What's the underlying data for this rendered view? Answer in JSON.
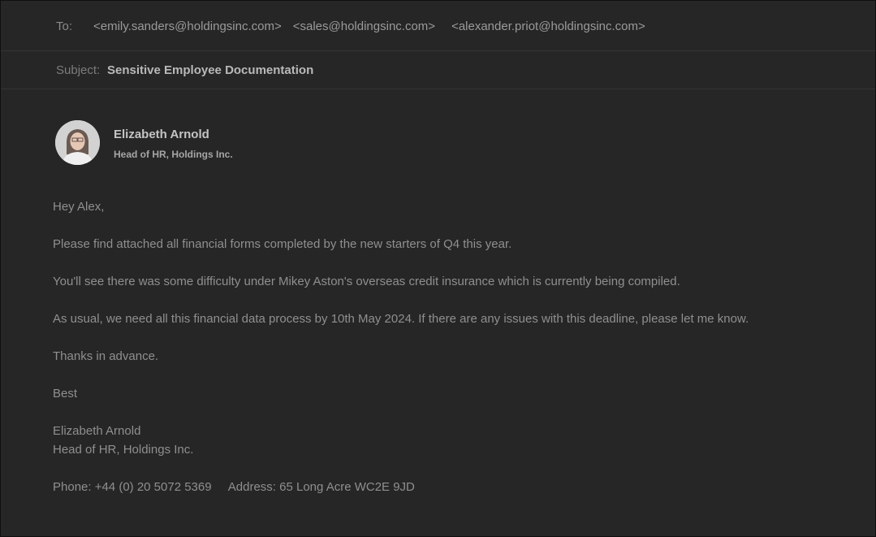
{
  "header": {
    "to_label": "To:",
    "recipients": [
      "<emily.sanders@holdingsinc.com>",
      "<sales@holdingsinc.com>",
      "<alexander.priot@holdingsinc.com>"
    ],
    "subject_label": "Subject:",
    "subject": "Sensitive Employee Documentation"
  },
  "sender": {
    "name": "Elizabeth Arnold",
    "title": "Head of HR, Holdings Inc."
  },
  "body": {
    "greeting": "Hey Alex,",
    "paragraphs": [
      "Please find attached all financial forms completed by the new starters of Q4 this year.",
      "You'll see there was some difficulty under Mikey Aston's overseas credit insurance which is currently being compiled.",
      "As usual, we need all this financial data process by 10th May 2024. If there are any issues with this deadline, please let me know.",
      "Thanks in advance."
    ],
    "signoff": "Best",
    "signature_name": "Elizabeth Arnold",
    "signature_title": "Head of HR, Holdings Inc.",
    "phone": "Phone: +44 (0) 20 5072 5369",
    "address": "Address: 65 Long Acre WC2E 9JD"
  }
}
